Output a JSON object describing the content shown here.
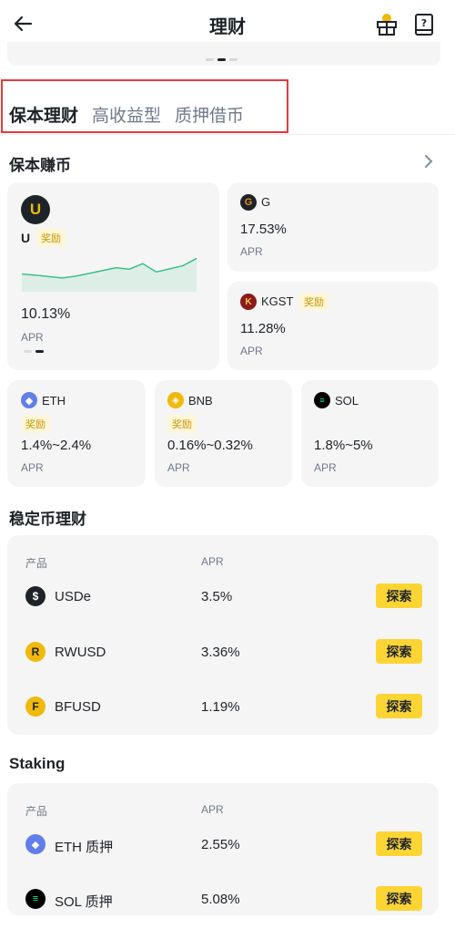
{
  "header": {
    "title": "理财",
    "back_icon": "back-arrow-icon",
    "gift_icon": "gift-icon",
    "book_icon": "book-icon"
  },
  "tabs": [
    "保本理财",
    "高收益型",
    "质押借币"
  ],
  "principal": {
    "title": "保本赚币",
    "featured": {
      "name": "U",
      "badge": "奖励",
      "rate": "10.13%",
      "apr": "APR",
      "sparkline": [
        0.4,
        0.37,
        0.33,
        0.29,
        0.34,
        0.42,
        0.5,
        0.58,
        0.54,
        0.7,
        0.46,
        0.55,
        0.64,
        0.85
      ]
    },
    "side": [
      {
        "name": "G",
        "rate": "17.53%",
        "apr": "APR",
        "badge": ""
      },
      {
        "name": "KGST",
        "rate": "11.28%",
        "apr": "APR",
        "badge": "奖励"
      }
    ],
    "small": [
      {
        "name": "ETH",
        "rate": "1.4%~2.4%",
        "apr": "APR",
        "badge": "奖励"
      },
      {
        "name": "BNB",
        "rate": "0.16%~0.32%",
        "apr": "APR",
        "badge": "奖励"
      },
      {
        "name": "SOL",
        "rate": "1.8%~5%",
        "apr": "APR",
        "badge": ""
      }
    ]
  },
  "stable": {
    "title": "稳定币理财",
    "col_product": "产品",
    "col_apr": "APR",
    "rows": [
      {
        "name": "USDe",
        "apr": "3.5%",
        "action": "探索"
      },
      {
        "name": "RWUSD",
        "apr": "3.36%",
        "action": "探索"
      },
      {
        "name": "BFUSD",
        "apr": "1.19%",
        "action": "探索"
      }
    ]
  },
  "staking": {
    "title": "Staking",
    "col_product": "产品",
    "col_apr": "APR",
    "rows": [
      {
        "name": "ETH 质押",
        "apr": "2.55%",
        "action": "探索"
      },
      {
        "name": "SOL 质押",
        "apr": "5.08%",
        "action": "探索"
      }
    ]
  },
  "colors": {
    "accent": "#fcd535",
    "highlight_border": "#e23b3b",
    "chart_line": "#2ebd85"
  }
}
